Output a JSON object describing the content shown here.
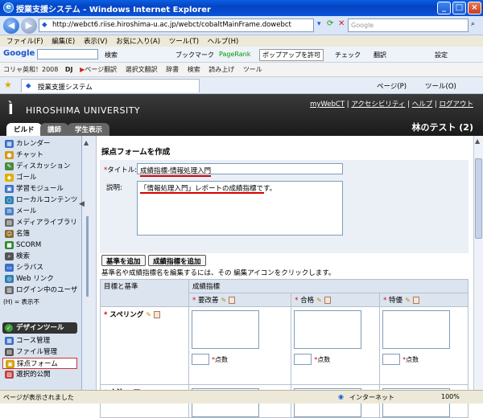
{
  "window": {
    "title": "授業支援システム - Windows Internet Explorer"
  },
  "address": {
    "url": "http://webct6.riise.hiroshima-u.ac.jp/webct/cobaltMainFrame.dowebct",
    "search_placeholder": "Google"
  },
  "menu": [
    "ファイル(F)",
    "編集(E)",
    "表示(V)",
    "お気に入り(A)",
    "ツール(T)",
    "ヘルプ(H)"
  ],
  "gtoolbar": {
    "logo": "Google",
    "items": [
      "検索",
      "ブックマーク",
      "PageRank",
      "ポップアップを許可",
      "チェック",
      "翻訳",
      "設定"
    ]
  },
  "tbar": {
    "items": [
      "コリャ英和！2008",
      "DJ",
      "ページ翻訳",
      "選択文翻訳",
      "辞書",
      "検索",
      "読み上げ",
      "ツール"
    ]
  },
  "tab": {
    "label": "授業支援システム",
    "tools": [
      "ページ(P)",
      "ツール(O)"
    ]
  },
  "header": {
    "university": "HIROSHIMA UNIVERSITY",
    "links": [
      "myWebCT",
      "アクセシビリティ",
      "ヘルプ",
      "ログアウト"
    ],
    "course": "林のテスト (2)",
    "tabs": [
      "ビルド",
      "講師",
      "学生表示"
    ]
  },
  "sidebar": {
    "items": [
      "カレンダー",
      "チャット",
      "ディスカッション",
      "ゴール",
      "学習モジュール",
      "ローカルコンテンツ",
      "メール",
      "メディアライブラリ",
      "名簿",
      "SCORM",
      "検索",
      "シラバス",
      "Web リンク",
      "ログイン中のユーザ"
    ],
    "hidden_note": "(H) = 表示不",
    "design_header": "デザインツール",
    "design_items": [
      "コース管理",
      "ファイル管理",
      "採点フォーム",
      "選択的公開"
    ]
  },
  "form": {
    "heading": "採点フォームを作成",
    "title_label": "タイトル:",
    "title_value": "成績指標-情報処理入門",
    "desc_label": "説明:",
    "desc_value": "「情報処理入門」レポートの成績指標です。",
    "add_criteria": "基準を追加",
    "add_level": "成績指標を追加",
    "instructions": "基準名や成績指標名を編集するには、その 編集アイコンをクリックします。",
    "col_criteria": "目標と基準",
    "col_levels": "成績指標",
    "levels": [
      "要改善",
      "合格",
      "特優"
    ],
    "points_label": "点数",
    "criteria": [
      "スペリング",
      "文法"
    ]
  },
  "status": {
    "left": "ページが表示されました",
    "zone": "インターネット",
    "zoom": "100%"
  },
  "colors": {
    "accent_red": "#d40000",
    "header_dark": "#1f1f1f",
    "sidebar_bg": "#d9e3f0"
  }
}
